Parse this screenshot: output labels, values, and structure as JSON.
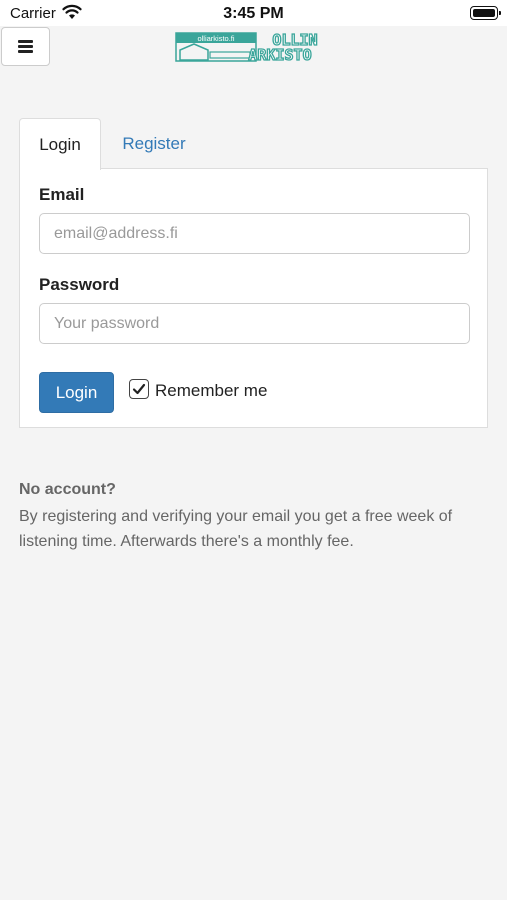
{
  "status_bar": {
    "carrier": "Carrier",
    "time": "3:45 PM"
  },
  "header": {
    "menu_icon": "hamburger-icon",
    "logo": {
      "small_text": "olliarkisto.fi",
      "word1": "OLLIN",
      "word2": "ARKISTO",
      "color": "#3aa59a"
    }
  },
  "tabs": [
    {
      "label": "Login",
      "active": true
    },
    {
      "label": "Register",
      "active": false
    }
  ],
  "form": {
    "email_label": "Email",
    "email_placeholder": "email@address.fi",
    "email_value": "",
    "password_label": "Password",
    "password_placeholder": "Your password",
    "password_value": "",
    "login_button": "Login",
    "remember_label": "Remember me",
    "remember_checked": true
  },
  "info": {
    "title": "No account?",
    "text": "By registering and verifying your email you get a free week of listening time. Afterwards there's a monthly fee."
  },
  "colors": {
    "primary": "#337ab7",
    "background": "#f4f4f4",
    "panel": "#ffffff",
    "border": "#dddddd"
  }
}
